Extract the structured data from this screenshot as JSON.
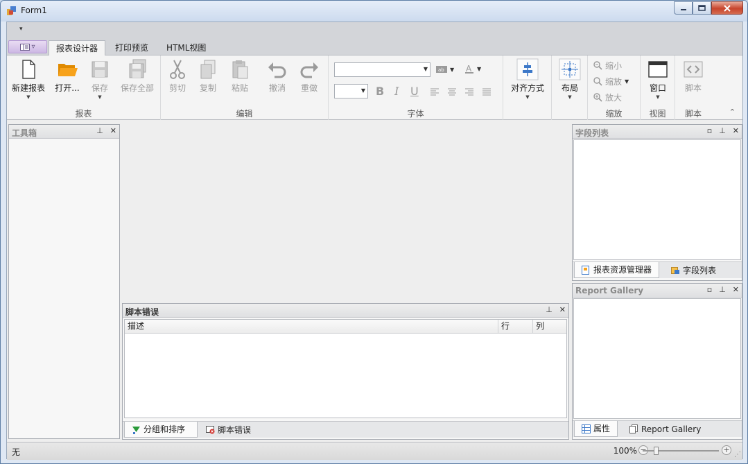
{
  "window": {
    "title": "Form1"
  },
  "ribbon_tabs": [
    {
      "label": "报表设计器",
      "active": true
    },
    {
      "label": "打印预览",
      "active": false
    },
    {
      "label": "HTML视图",
      "active": false
    }
  ],
  "groups": {
    "report": {
      "label": "报表",
      "new": "新建报表",
      "open": "打开...",
      "save": "保存",
      "save_all": "保存全部"
    },
    "edit": {
      "label": "编辑",
      "cut": "剪切",
      "copy": "复制",
      "paste": "粘贴",
      "undo": "撤消",
      "redo": "重做"
    },
    "font": {
      "label": "字体",
      "font_name": "",
      "font_size": "",
      "bold": "B",
      "italic": "I",
      "underline": "U"
    },
    "align": {
      "label": "对齐方式"
    },
    "layout": {
      "label": "布局"
    },
    "zoom": {
      "label": "缩放",
      "zoom_out": "缩小",
      "zoom": "缩放",
      "zoom_in": "放大"
    },
    "view": {
      "label": "视图",
      "window": "窗口"
    },
    "script": {
      "label": "脚本",
      "script": "脚本"
    }
  },
  "panels": {
    "toolbox": {
      "title": "工具箱"
    },
    "field_list": {
      "title": "字段列表"
    },
    "field_tabs": [
      {
        "label": "报表资源管理器",
        "active": true
      },
      {
        "label": "字段列表",
        "active": false
      }
    ],
    "gallery": {
      "title": "Report Gallery"
    },
    "gallery_tabs": [
      {
        "label": "属性",
        "active": true
      },
      {
        "label": "Report Gallery",
        "active": false
      }
    ],
    "script_errors": {
      "title": "脚本错误",
      "columns": [
        "描述",
        "行",
        "列"
      ]
    },
    "bottom_tabs": [
      {
        "label": "分组和排序",
        "active": true
      },
      {
        "label": "脚本错误",
        "active": false
      }
    ]
  },
  "status": {
    "left": "无",
    "zoom": "100%"
  },
  "colors": {
    "accent_orange": "#f7a21b",
    "ribbon_bg": "#f4f4f4",
    "title_bg": "#d4e1f2"
  }
}
